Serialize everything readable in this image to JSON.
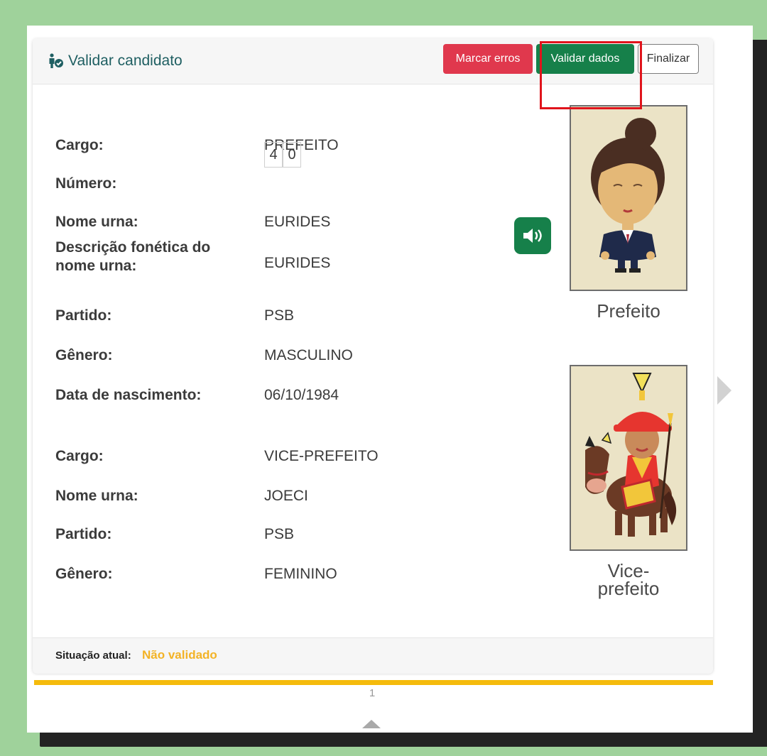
{
  "header": {
    "title": "Validar candidato",
    "buttons": {
      "mark_errors": "Marcar erros",
      "validate": "Validar dados",
      "finish": "Finalizar"
    }
  },
  "candidate": {
    "rows": [
      {
        "label": "Cargo:",
        "value": "PREFEITO"
      },
      {
        "label": "Número:",
        "digits": [
          "4",
          "0"
        ]
      },
      {
        "label": "Nome urna:",
        "value": "EURIDES"
      },
      {
        "label": "Descrição fonética do nome urna:",
        "value": "EURIDES"
      },
      {
        "label": "Partido:",
        "value": "PSB"
      },
      {
        "label": "Gênero:",
        "value": "MASCULINO"
      },
      {
        "label": "Data de nascimento:",
        "value": "06/10/1984"
      }
    ]
  },
  "vice": {
    "rows": [
      {
        "label": "Cargo:",
        "value": "VICE-PREFEITO"
      },
      {
        "label": "Nome urna:",
        "value": "JOECI"
      },
      {
        "label": "Partido:",
        "value": "PSB"
      },
      {
        "label": "Gênero:",
        "value": "FEMININO"
      }
    ]
  },
  "photos": {
    "mayor_caption": "Prefeito",
    "vice_caption_line1": "Vice-",
    "vice_caption_line2": "prefeito"
  },
  "footer": {
    "status_label": "Situação atual:",
    "status_value": "Não validado"
  },
  "pagination": {
    "page": "1"
  },
  "colors": {
    "page_background": "#9fd29b",
    "danger": "#e0384d",
    "success": "#16804a",
    "warning": "#f3b326",
    "highlight_border": "#e0141c",
    "title": "#1f5f62"
  },
  "icons": {
    "title_icon": "person-check-icon",
    "sound_icon": "volume-icon",
    "next_icon": "chevron-right-icon",
    "scroll_up_icon": "caret-up-icon"
  }
}
